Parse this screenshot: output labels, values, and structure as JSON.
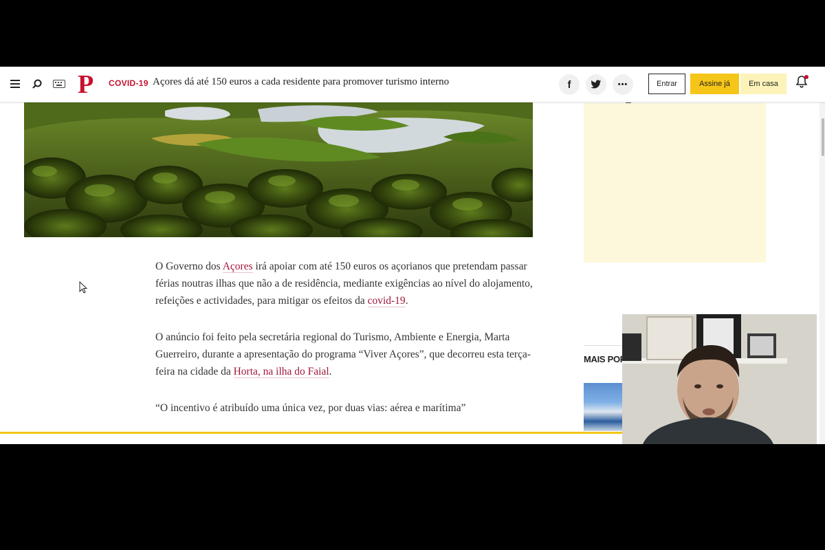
{
  "header": {
    "menu_icon": "menu-icon",
    "search_icon": "search-icon",
    "keyboard_icon": "keyboard-icon",
    "logo": "P",
    "section": "COVID-19",
    "headline": "Açores dá até 150 euros a cada residente para promover turismo interno",
    "share": {
      "facebook": "f",
      "twitter": "twitter-icon",
      "more": "•••"
    },
    "login_label": "Entrar",
    "subscribe_label": "Assine já",
    "home_label": "Em casa",
    "bell_icon": "bell-icon"
  },
  "article": {
    "p1_before": "O Governo dos ",
    "p1_link1": "Açores",
    "p1_middle": " irá apoiar com até 150 euros os açorianos que pretendam passar férias noutras ilhas que não a de residência, mediante exigências ao nível do alojamento, refeições e actividades, para mitigar os efeitos da ",
    "p1_link2": "covid-19",
    "p1_after": ".",
    "p2_before": "O anúncio foi feito pela secretária regional do Turismo, Ambiente e Energia, Marta Guerreiro, durante a apresentação do programa “Viver Açores”, que decorreu esta terça-feira na cidade da ",
    "p2_link": "Horta, na ilha do Faial",
    "p2_after": ".",
    "p3": "“O incentivo é atribuído uma única vez, por duas vias: aérea e marítima”"
  },
  "sidebar": {
    "popular_label": "MAIS POPU"
  },
  "colors": {
    "brand_red": "#c8102e",
    "subscribe_yellow": "#f5c518",
    "home_yellow": "#fdf3b8",
    "link": "#a3173a"
  }
}
